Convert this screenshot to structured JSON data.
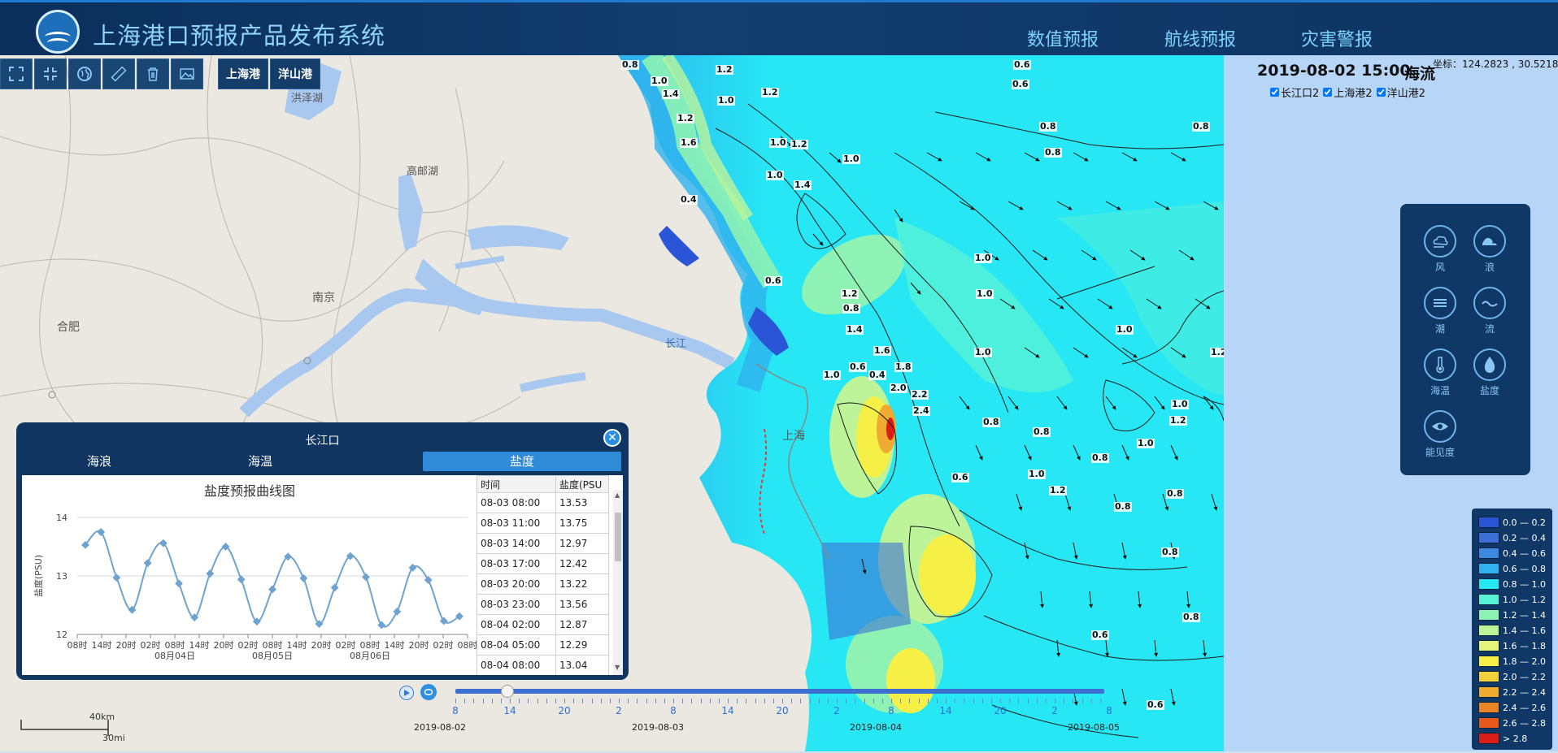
{
  "header": {
    "title": "上海港口预报产品发布系统",
    "nav": [
      "数值预报",
      "航线预报",
      "灾害警报"
    ]
  },
  "toolbar": {
    "tools": [
      "fullscreen-icon",
      "shrink-icon",
      "globe-icon",
      "ruler-icon",
      "trash-icon",
      "image-icon"
    ],
    "ports": [
      "上海港",
      "洋山港"
    ]
  },
  "map": {
    "place_labels": [
      "洪泽湖",
      "高邮湖",
      "南京",
      "合肥",
      "长江",
      "上海"
    ],
    "contour_labels": [
      "0.8",
      "1.2",
      "1.0",
      "1.4",
      "1.2",
      "1.0",
      "1.2",
      "1.6",
      "1.0",
      "1.2",
      "0.6",
      "0.8",
      "0.6",
      "0.4",
      "1.0",
      "0.8",
      "1.4",
      "1.0",
      "1.0",
      "0.8",
      "0.6",
      "1.8",
      "2.2",
      "2.4",
      "2.0",
      "0.4",
      "1.0",
      "1.6",
      "1.4",
      "1.0",
      "0.8",
      "1.2",
      "1.0",
      "0.8",
      "0.6",
      "0.8",
      "1.0",
      "1.2",
      "1.0",
      "1.2",
      "1.0",
      "0.8",
      "0.8",
      "0.8",
      "1.0",
      "0.6",
      "1.2",
      "0.8",
      "0.6",
      "0.8",
      "0.6"
    ],
    "coord_label": "坐标：124.2823 , 30.5218",
    "timestamp": "2019-08-02 15:00",
    "layer_title": "海流",
    "stations": [
      {
        "label": "长江口2",
        "checked": true
      },
      {
        "label": "上海港2",
        "checked": true
      },
      {
        "label": "洋山港2",
        "checked": true
      }
    ]
  },
  "layers": [
    {
      "label": "风",
      "icon": "cloud-wind-icon"
    },
    {
      "label": "浪",
      "icon": "wave-icon"
    },
    {
      "label": "潮",
      "icon": "tide-icon"
    },
    {
      "label": "流",
      "icon": "current-icon"
    },
    {
      "label": "海温",
      "icon": "thermometer-icon"
    },
    {
      "label": "盐度",
      "icon": "salinity-drop-icon"
    },
    {
      "label": "能见度",
      "icon": "eye-icon"
    }
  ],
  "legend": [
    {
      "label": "0.0 — 0.2",
      "color": "#2a55d6"
    },
    {
      "label": "0.2 — 0.4",
      "color": "#3e6fd4"
    },
    {
      "label": "0.4 — 0.6",
      "color": "#3d89e0"
    },
    {
      "label": "0.6 — 0.8",
      "color": "#2fb2ee"
    },
    {
      "label": "0.8 — 1.0",
      "color": "#27e7f4"
    },
    {
      "label": "1.0 — 1.2",
      "color": "#58f2d6"
    },
    {
      "label": "1.2 — 1.4",
      "color": "#8ef2b4"
    },
    {
      "label": "1.4 — 1.6",
      "color": "#bdf49a"
    },
    {
      "label": "1.6 — 1.8",
      "color": "#e2f57a"
    },
    {
      "label": "1.8 — 2.0",
      "color": "#f6f046"
    },
    {
      "label": "2.0 — 2.2",
      "color": "#f2d13b"
    },
    {
      "label": "2.2 — 2.4",
      "color": "#eeaa31"
    },
    {
      "label": "2.4 — 2.6",
      "color": "#e98427"
    },
    {
      "label": "2.6 — 2.8",
      "color": "#e55a1c"
    },
    {
      "label": ">   2.8",
      "color": "#d81e16"
    }
  ],
  "popup": {
    "title": "长江口",
    "tabs": [
      "海浪",
      "海温",
      "盐度"
    ],
    "active_tab": "盐度",
    "table_headers": [
      "时间",
      "盐度(PSU"
    ],
    "rows": [
      [
        "08-03 08:00",
        "13.53"
      ],
      [
        "08-03 11:00",
        "13.75"
      ],
      [
        "08-03 14:00",
        "12.97"
      ],
      [
        "08-03 17:00",
        "12.42"
      ],
      [
        "08-03 20:00",
        "13.22"
      ],
      [
        "08-03 23:00",
        "13.56"
      ],
      [
        "08-04 02:00",
        "12.87"
      ],
      [
        "08-04 05:00",
        "12.29"
      ],
      [
        "08-04 08:00",
        "13.04"
      ]
    ]
  },
  "chart_data": {
    "type": "line",
    "title": "盐度预报曲线图",
    "ylabel": "盐度(PSU)",
    "xlabel": "",
    "ylim": [
      12,
      14
    ],
    "yticks": [
      12,
      13,
      14
    ],
    "x_tick_labels": [
      "08时",
      "14时",
      "20时",
      "02时",
      "08时",
      "14时",
      "20时",
      "02时",
      "08时",
      "14时",
      "20时",
      "02时",
      "08时",
      "14时",
      "20时",
      "02时",
      "08时"
    ],
    "x_date_labels": [
      "08月04日",
      "08月05日",
      "08月06日"
    ],
    "grid": true,
    "series": [
      {
        "color": "#6fa3cf",
        "values": [
          13.53,
          13.75,
          12.97,
          12.42,
          13.22,
          13.56,
          12.87,
          12.29,
          13.04,
          13.5,
          12.94,
          12.22,
          12.77,
          13.33,
          12.96,
          12.18,
          12.8,
          13.34,
          12.98,
          12.16,
          12.39,
          13.14,
          12.93,
          12.23,
          12.31
        ]
      }
    ]
  },
  "timeline": {
    "hour_ticks": [
      "8",
      "14",
      "20",
      "2",
      "8",
      "14",
      "20",
      "2",
      "8",
      "14",
      "20",
      "2",
      "8"
    ],
    "dates": [
      "2019-08-02",
      "2019-08-03",
      "2019-08-04",
      "2019-08-05"
    ],
    "position": 0.08
  },
  "scale": {
    "km": "40km",
    "mi": "30mi"
  }
}
